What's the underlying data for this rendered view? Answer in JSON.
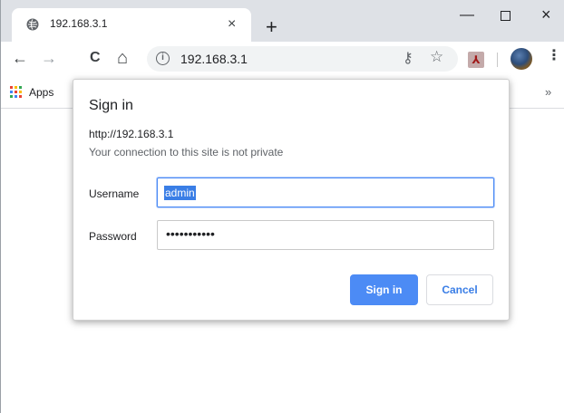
{
  "tab": {
    "title": "192.168.3.1",
    "close": "×",
    "new_tab": "+"
  },
  "window": {
    "minimize": "—",
    "close": "×"
  },
  "toolbar": {
    "back": "←",
    "forward": "→",
    "reload": "C",
    "home": "⌂",
    "url": "192.168.3.1",
    "info": "i",
    "key": "⚷",
    "star": "☆",
    "menu": "⋮"
  },
  "bookmarks": {
    "apps_label": "Apps",
    "overflow": "»"
  },
  "dialog": {
    "title": "Sign in",
    "origin": "http://192.168.3.1",
    "warning": "Your connection to this site is not private",
    "username_label": "Username",
    "username_value": "admin",
    "password_label": "Password",
    "password_mask": "•••••••••••",
    "signin_label": "Sign in",
    "cancel_label": "Cancel"
  },
  "colors": {
    "accent": "#4c8bf5",
    "tabstrip": "#dee1e6",
    "selection": "#3a7ee6"
  }
}
